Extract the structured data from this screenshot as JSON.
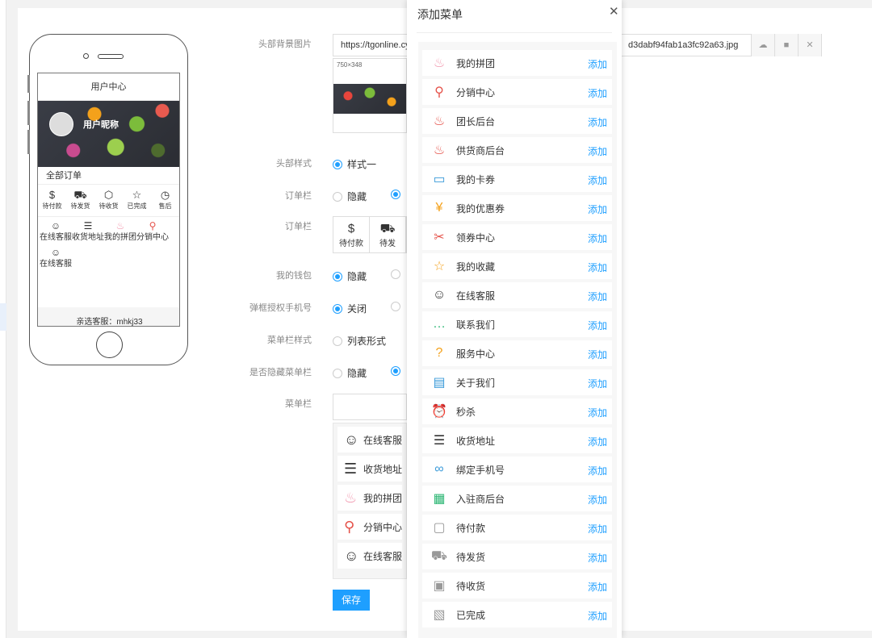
{
  "phone": {
    "title": "用户中心",
    "nickname": "用户昵称",
    "all_orders": "全部订单",
    "order_icons": [
      {
        "glyph": "$",
        "label": "待付款"
      },
      {
        "glyph": "⛟",
        "label": "待发货"
      },
      {
        "glyph": "⬡",
        "label": "待收货"
      },
      {
        "glyph": "☆",
        "label": "已完成"
      },
      {
        "glyph": "◷",
        "label": "售后"
      }
    ],
    "menu_items": [
      {
        "glyph": "☺",
        "label": "在线客服"
      },
      {
        "glyph": "☰",
        "label": "收货地址"
      },
      {
        "glyph": "♨",
        "label": "我的拼团"
      },
      {
        "glyph": "⚲",
        "label": "分销中心"
      },
      {
        "glyph": "☺",
        "label": "在线客服"
      }
    ],
    "footer": "亲选客服：mhkj33"
  },
  "form": {
    "header_bg_label": "头部背景图片",
    "header_bg_url_start": "https://tgonline.cy",
    "header_bg_url_end": "d3dabf94fab1a3fc92a63.jpg",
    "img_size_hint": "750×348",
    "header_style_label": "头部样式",
    "header_style_opt1": "样式一",
    "order_bar_label": "订单栏",
    "order_bar_hide": "隐藏",
    "order_bar2_label": "订单栏",
    "order_box_items": [
      {
        "glyph": "$",
        "label": "待付款"
      },
      {
        "glyph": "⛟",
        "label": "待发"
      }
    ],
    "wallet_label": "我的钱包",
    "wallet_hide": "隐藏",
    "popup_phone_label": "弹框授权手机号",
    "popup_phone_off": "关闭",
    "menu_style_label": "菜单栏样式",
    "menu_style_list": "列表形式",
    "hide_menu_label": "是否隐藏菜单栏",
    "hide_menu_hide": "隐藏",
    "menu_bar_label": "菜单栏",
    "menu_list": [
      {
        "glyph": "☺",
        "label": "在线客服"
      },
      {
        "glyph": "☰",
        "label": "收货地址"
      },
      {
        "glyph": "♨",
        "label": "我的拼团"
      },
      {
        "glyph": "⚲",
        "label": "分销中心"
      },
      {
        "glyph": "☺",
        "label": "在线客服"
      }
    ],
    "save": "保存"
  },
  "modal": {
    "title": "添加菜单",
    "close": "✕",
    "add_label": "添加",
    "items": [
      {
        "label": "我的拼团",
        "icon": "group-buy-icon",
        "glyph": "♨",
        "color": "#f29bb1"
      },
      {
        "label": "分销中心",
        "icon": "distribution-icon",
        "glyph": "⚲",
        "color": "#e5534b"
      },
      {
        "label": "团长后台",
        "icon": "leader-icon",
        "glyph": "♨",
        "color": "#e5534b"
      },
      {
        "label": "供货商后台",
        "icon": "supplier-icon",
        "glyph": "♨",
        "color": "#e5534b"
      },
      {
        "label": "我的卡券",
        "icon": "card-icon",
        "glyph": "▭",
        "color": "#3a9ad9"
      },
      {
        "label": "我的优惠券",
        "icon": "coupon-icon",
        "glyph": "¥",
        "color": "#f4a11b"
      },
      {
        "label": "领券中心",
        "icon": "ticket-icon",
        "glyph": "✂",
        "color": "#e5534b"
      },
      {
        "label": "我的收藏",
        "icon": "star-icon",
        "glyph": "☆",
        "color": "#f4a11b"
      },
      {
        "label": "在线客服",
        "icon": "service-icon",
        "glyph": "☺",
        "color": "#333333"
      },
      {
        "label": "联系我们",
        "icon": "chat-icon",
        "glyph": "…",
        "color": "#2bb673"
      },
      {
        "label": "服务中心",
        "icon": "help-icon",
        "glyph": "?",
        "color": "#f4a11b"
      },
      {
        "label": "关于我们",
        "icon": "about-icon",
        "glyph": "▤",
        "color": "#3a9ad9"
      },
      {
        "label": "秒杀",
        "icon": "clock-icon",
        "glyph": "⏰",
        "color": "#e5534b"
      },
      {
        "label": "收货地址",
        "icon": "address-icon",
        "glyph": "☰",
        "color": "#333333"
      },
      {
        "label": "绑定手机号",
        "icon": "link-icon",
        "glyph": "∞",
        "color": "#3a9ad9"
      },
      {
        "label": "入驻商后台",
        "icon": "shop-icon",
        "glyph": "▦",
        "color": "#2bb673"
      },
      {
        "label": "待付款",
        "icon": "wallet-icon",
        "glyph": "▢",
        "color": "#999999"
      },
      {
        "label": "待发货",
        "icon": "truck-icon",
        "glyph": "⛟",
        "color": "#999999"
      },
      {
        "label": "待收货",
        "icon": "box-icon",
        "glyph": "▣",
        "color": "#999999"
      },
      {
        "label": "已完成",
        "icon": "done-icon",
        "glyph": "▧",
        "color": "#999999"
      }
    ]
  },
  "colors": {
    "accent": "#1e9fff",
    "link": "#1e9fff"
  }
}
